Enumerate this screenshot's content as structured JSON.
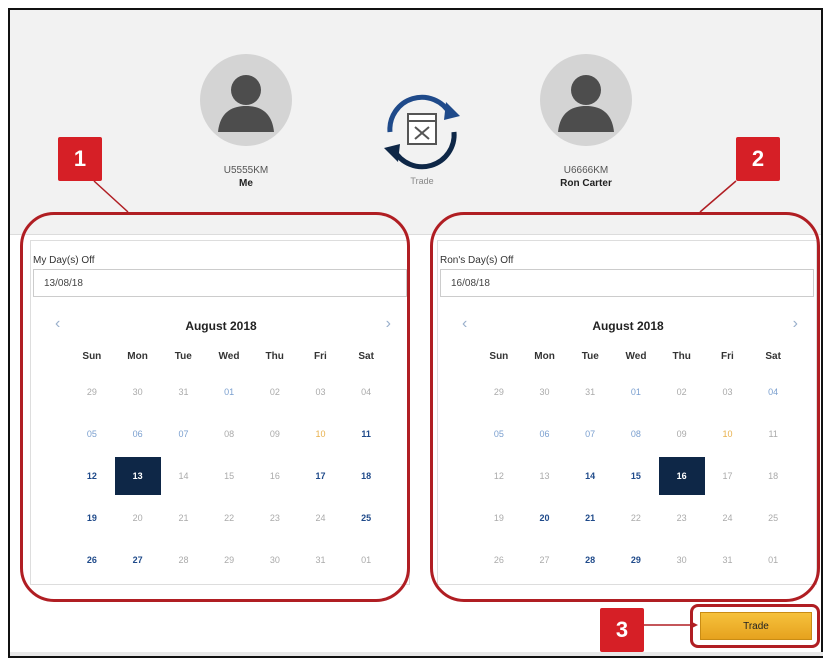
{
  "header": {
    "left_user": {
      "id": "U5555KM",
      "name": "Me"
    },
    "right_user": {
      "id": "U6666KM",
      "name": "Ron Carter"
    },
    "trade_caption": "Trade"
  },
  "left_panel": {
    "label": "My Day(s) Off",
    "date_value": "13/08/18",
    "month_title": "August 2018",
    "weekdays": [
      "Sun",
      "Mon",
      "Tue",
      "Wed",
      "Thu",
      "Fri",
      "Sat"
    ],
    "days": [
      [
        "29",
        "30",
        "31",
        "01",
        "02",
        "03",
        "04"
      ],
      [
        "05",
        "06",
        "07",
        "08",
        "09",
        "10",
        "11"
      ],
      [
        "12",
        "13",
        "14",
        "15",
        "16",
        "17",
        "18"
      ],
      [
        "19",
        "20",
        "21",
        "22",
        "23",
        "24",
        "25"
      ],
      [
        "26",
        "27",
        "28",
        "29",
        "30",
        "31",
        "01"
      ]
    ],
    "selected": "13"
  },
  "right_panel": {
    "label": "Ron's Day(s) Off",
    "date_value": "16/08/18",
    "month_title": "August 2018",
    "weekdays": [
      "Sun",
      "Mon",
      "Tue",
      "Wed",
      "Thu",
      "Fri",
      "Sat"
    ],
    "days": [
      [
        "29",
        "30",
        "31",
        "01",
        "02",
        "03",
        "04"
      ],
      [
        "05",
        "06",
        "07",
        "08",
        "09",
        "10",
        "11"
      ],
      [
        "12",
        "13",
        "14",
        "15",
        "16",
        "17",
        "18"
      ],
      [
        "19",
        "20",
        "21",
        "22",
        "23",
        "24",
        "25"
      ],
      [
        "26",
        "27",
        "28",
        "29",
        "30",
        "31",
        "01"
      ]
    ],
    "selected": "16"
  },
  "callouts": {
    "one": "1",
    "two": "2",
    "three": "3"
  },
  "actions": {
    "trade_button": "Trade"
  },
  "colors": {
    "selected_day": "#0e2747",
    "callout_red": "#d61f26",
    "outline_red": "#b01e23",
    "trade_button": "#f2b431"
  }
}
